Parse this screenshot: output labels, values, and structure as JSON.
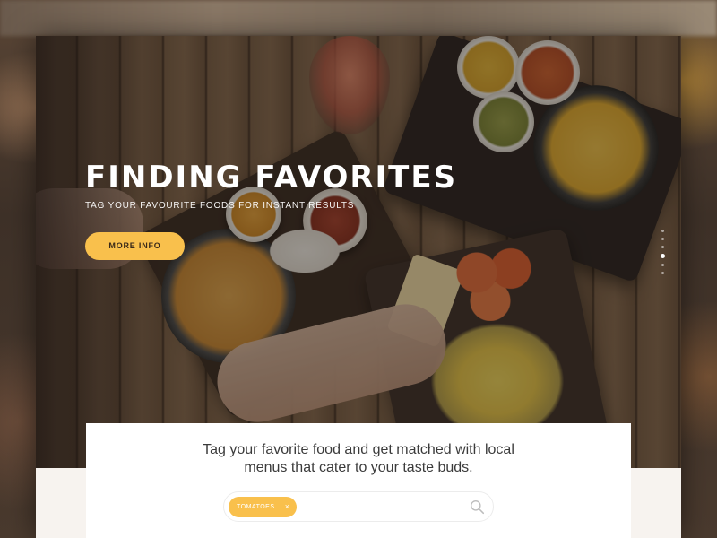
{
  "hero": {
    "title": "FINDING FAVORITES",
    "subtitle": "TAG YOUR FAVOURITE FOODS FOR INSTANT RESULTS",
    "cta_label": "MORE INFO",
    "slider": {
      "total": 6,
      "active_index": 4
    }
  },
  "intro": {
    "line1": "Tag your favorite food and get matched with local",
    "line2": "menus that cater to your taste buds."
  },
  "search": {
    "tags": [
      {
        "label": "TOMATOES",
        "remove_symbol": "×"
      }
    ],
    "icon": "search-icon"
  },
  "colors": {
    "accent": "#f9c04c",
    "panel_bg": "#ffffff",
    "page_bg": "#f7f3ef",
    "text_dark": "#3b3b3b"
  }
}
